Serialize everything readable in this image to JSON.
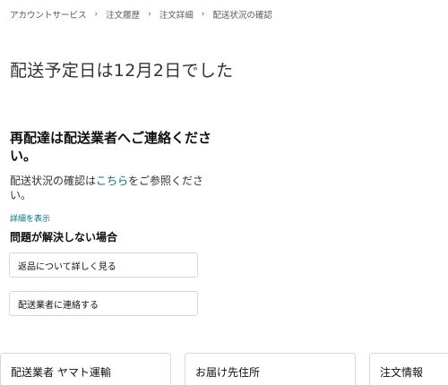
{
  "breadcrumb": {
    "items": [
      "アカウントサービス",
      "注文履歴",
      "注文詳細",
      "配送状況の確認"
    ],
    "separator": "›"
  },
  "delivery": {
    "title": "配送予定日は12月2日でした"
  },
  "redelivery": {
    "heading": "再配達は配送業者へご連絡ください。",
    "tracking_prefix": "配送状況の確認は",
    "tracking_link": "こちら",
    "tracking_suffix": "をご参照ください。",
    "details_link": "詳細を表示"
  },
  "problem": {
    "heading": "問題が解決しない場合",
    "return_button": "返品について詳しく見る",
    "contact_button": "配送業者に連絡する"
  },
  "cards": {
    "carrier": "配送業者 ヤマト運輸",
    "address": "お届け先住所",
    "order": "注文情報"
  },
  "colors": {
    "link": "#007185",
    "text": "#0f1111",
    "muted": "#565959",
    "border": "#d5d9d9"
  }
}
